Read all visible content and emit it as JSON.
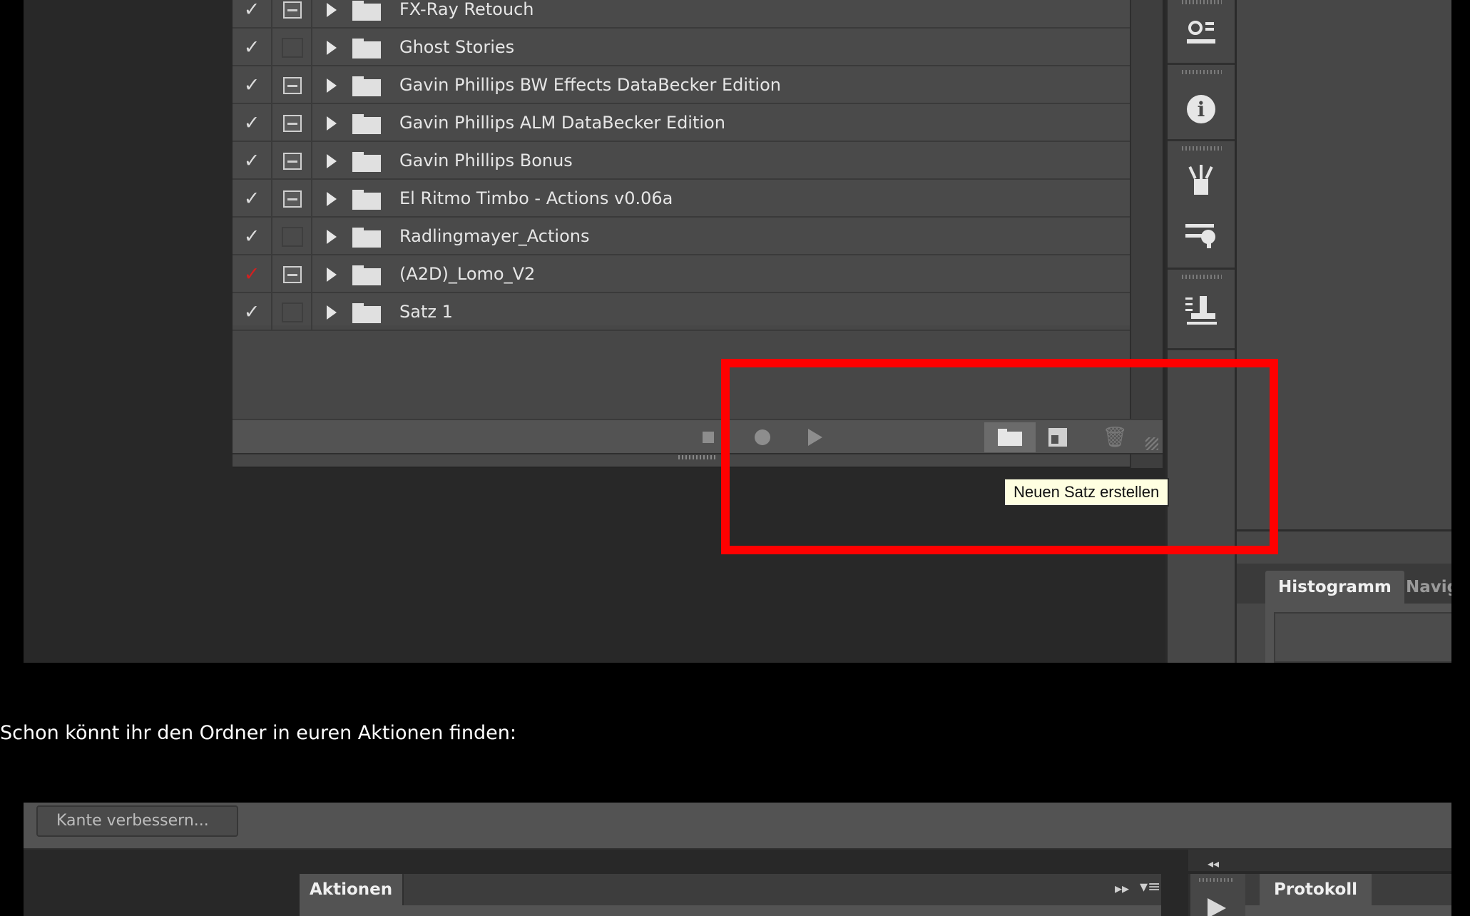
{
  "top_screenshot": {
    "action_sets": [
      {
        "name": "FX-Ray Retouch",
        "checked": true,
        "check_color": "#dcdcdc",
        "dialog_toggle": true
      },
      {
        "name": "Ghost Stories",
        "checked": true,
        "check_color": "#dcdcdc",
        "dialog_toggle": false
      },
      {
        "name": "Gavin Phillips BW Effects DataBecker Edition",
        "checked": true,
        "check_color": "#dcdcdc",
        "dialog_toggle": true
      },
      {
        "name": "Gavin Phillips ALM DataBecker Edition",
        "checked": true,
        "check_color": "#dcdcdc",
        "dialog_toggle": true
      },
      {
        "name": "Gavin Phillips  Bonus",
        "checked": true,
        "check_color": "#dcdcdc",
        "dialog_toggle": true
      },
      {
        "name": "El Ritmo Timbo - Actions v0.06a",
        "checked": true,
        "check_color": "#dcdcdc",
        "dialog_toggle": true
      },
      {
        "name": "Radlingmayer_Actions",
        "checked": true,
        "check_color": "#dcdcdc",
        "dialog_toggle": false
      },
      {
        "name": "(A2D)_Lomo_V2",
        "checked": true,
        "check_color": "#d32020",
        "dialog_toggle": true
      },
      {
        "name": "Satz 1",
        "checked": true,
        "check_color": "#dcdcdc",
        "dialog_toggle": false
      }
    ],
    "toolbar_buttons": [
      {
        "icon": "stop-icon"
      },
      {
        "icon": "record-icon"
      },
      {
        "icon": "play-icon"
      },
      {
        "icon": "new-set-folder-icon",
        "active": true
      },
      {
        "icon": "new-action-icon"
      },
      {
        "icon": "trash-icon"
      }
    ],
    "tooltip": "Neuen Satz erstellen",
    "highlight_color": "#ff0000",
    "dock_icons": [
      "3d-icon",
      "info-icon",
      "brushes-icon",
      "brush-settings-icon",
      "clone-source-icon"
    ],
    "right_tabs": {
      "histogram": "Histogramm",
      "navigator": "Naviga"
    }
  },
  "caption": "Schon könnt ihr den Ordner in euren Aktionen finden:",
  "bottom_screenshot": {
    "refine_edge_button": "Kante verbessern...",
    "actions_tab": "Aktionen",
    "history_tab": "Protokoll",
    "fold_glyph": "▸▸",
    "menu_glyph": "▾≡",
    "collapse_glyph": "◂◂"
  }
}
